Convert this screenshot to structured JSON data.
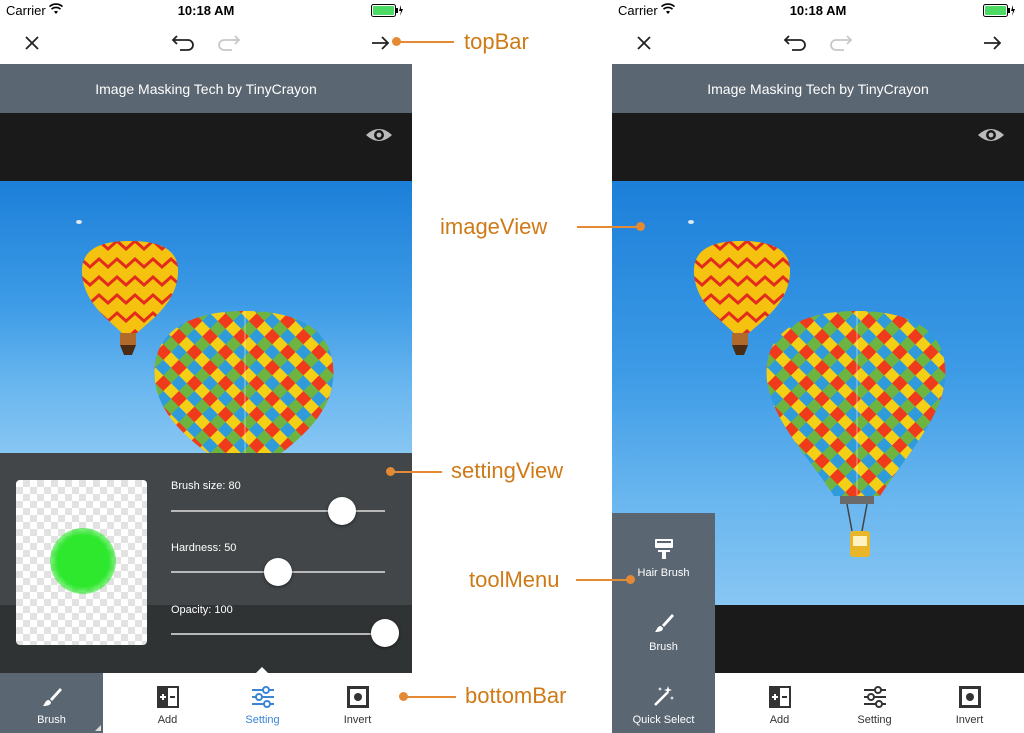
{
  "status_bar": {
    "carrier": "Carrier",
    "time": "10:18 AM"
  },
  "image_title": "Image Masking Tech by TinyCrayon",
  "settings": {
    "brush_size_label": "Brush size: 80",
    "brush_size": 80,
    "hardness_label": "Hardness: 50",
    "hardness": 50,
    "opacity_label": "Opacity: 100",
    "opacity": 100
  },
  "bottom_bar": {
    "brush": "Brush",
    "add": "Add",
    "setting": "Setting",
    "invert": "Invert"
  },
  "tool_menu": {
    "hair_brush": "Hair Brush",
    "brush": "Brush",
    "quick_select": "Quick Select"
  },
  "callouts": {
    "top_bar": "topBar",
    "image_view": "imageView",
    "setting_view": "settingView",
    "tool_menu": "toolMenu",
    "bottom_bar": "bottomBar"
  },
  "colors": {
    "bar_gray": "#5a6672",
    "accent_blue": "#3b84d6",
    "callout_orange": "#cf7a17",
    "preview_green": "#2ee82e",
    "battery_green": "#4cd964"
  },
  "icons": [
    "close-icon",
    "undo-icon",
    "redo-icon",
    "forward-arrow-icon",
    "eye-icon",
    "wifi-icon",
    "battery-icon",
    "brush-icon",
    "add-icon",
    "setting-icon",
    "invert-icon",
    "hair-brush-icon",
    "quick-select-icon"
  ]
}
